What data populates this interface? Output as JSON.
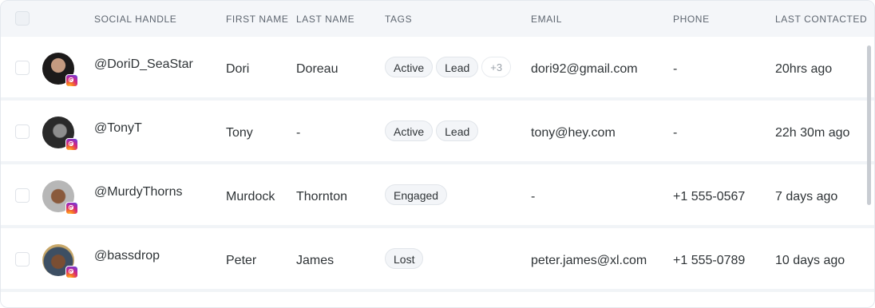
{
  "columns": {
    "social_handle": "SOCIAL HANDLE",
    "first_name": "FIRST NAME",
    "last_name": "LAST NAME",
    "tags": "TAGS",
    "email": "EMAIL",
    "phone": "PHONE",
    "last_contacted": "LAST CONTACTED"
  },
  "rows": [
    {
      "handle": "@DoriD_SeaStar",
      "first_name": "Dori",
      "last_name": "Doreau",
      "tags": [
        "Active",
        "Lead"
      ],
      "more_tags": "+3",
      "email": "dori92@gmail.com",
      "phone": "-",
      "last_contacted": "20hrs ago"
    },
    {
      "handle": "@TonyT",
      "first_name": "Tony",
      "last_name": "-",
      "tags": [
        "Active",
        "Lead"
      ],
      "email": "tony@hey.com",
      "phone": "-",
      "last_contacted": "22h 30m ago"
    },
    {
      "handle": "@MurdyThorns",
      "first_name": "Murdock",
      "last_name": "Thornton",
      "tags": [
        "Engaged"
      ],
      "email": "-",
      "phone": "+1 555-0567",
      "last_contacted": "7 days ago"
    },
    {
      "handle": "@bassdrop",
      "first_name": "Peter",
      "last_name": "James",
      "tags": [
        "Lost"
      ],
      "email": "peter.james@xl.com",
      "phone": "+1 555-0789",
      "last_contacted": "10 days ago"
    }
  ],
  "icons": {
    "social_badge": "instagram-icon"
  }
}
